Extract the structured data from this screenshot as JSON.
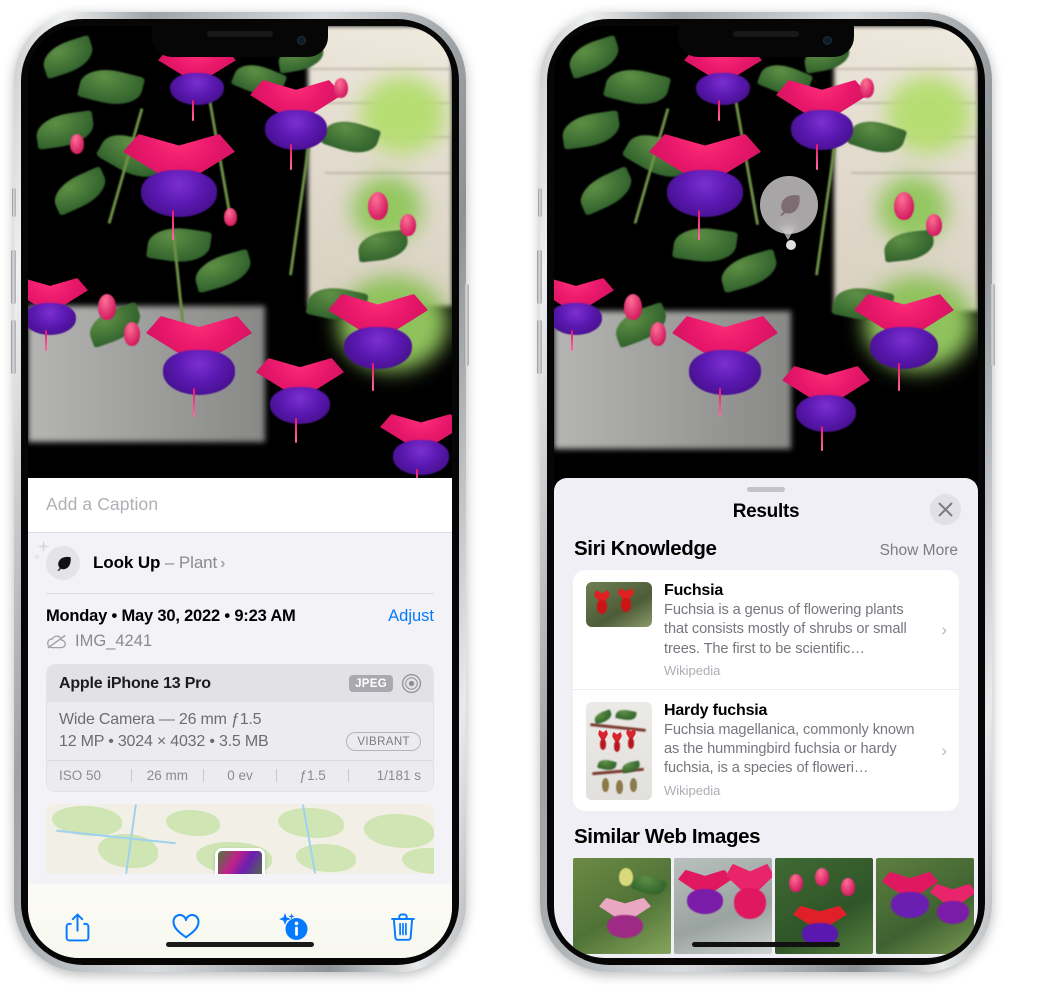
{
  "left_phone": {
    "name": "iPhone Photos detail view",
    "caption_field": {
      "placeholder": "Add a Caption",
      "value": ""
    },
    "lookup_row": {
      "title": "Look Up",
      "dash": " – ",
      "subject": "Plant",
      "chevron": "›",
      "icon": "leaf-icon"
    },
    "date_row": {
      "date_text": "Monday • May 30, 2022 • 9:23 AM",
      "adjust_label": "Adjust"
    },
    "filename_row": {
      "icon": "icloud-slash-icon",
      "filename": "IMG_4241"
    },
    "metadata_card": {
      "device": "Apple iPhone 13 Pro",
      "format_badge": "JPEG",
      "aperture_icon": "camera-aperture-icon",
      "lens_line": "Wide Camera — 26 mm ƒ1.5",
      "size_line": "12 MP • 3024 × 4032 • 3.5 MB",
      "style_badge": "VIBRANT",
      "exif": [
        {
          "label": "ISO 50"
        },
        {
          "label": "26 mm"
        },
        {
          "label": "0 ev"
        },
        {
          "label": "ƒ1.5"
        },
        {
          "label": "1/181 s"
        }
      ]
    },
    "map_preview": {
      "name": "location-map-thumbnail"
    },
    "toolbar": [
      {
        "name": "share-button",
        "icon": "share-icon"
      },
      {
        "name": "favorite-button",
        "icon": "heart-icon"
      },
      {
        "name": "info-button",
        "icon": "info-sparkle-icon"
      },
      {
        "name": "delete-button",
        "icon": "trash-icon"
      }
    ]
  },
  "right_phone": {
    "name": "Visual Look Up results sheet",
    "photo_badge": {
      "icon": "leaf-icon",
      "label": "visual-look-up-plant-badge"
    },
    "sheet": {
      "title": "Results",
      "close_label": "✕",
      "sections": [
        {
          "title": "Siri Knowledge",
          "action": "Show More",
          "cards": [
            {
              "title": "Fuchsia",
              "description": "Fuchsia is a genus of flowering plants that consists mostly of shrubs or small trees. The first to be scientific…",
              "source": "Wikipedia",
              "chevron": "›"
            },
            {
              "title": "Hardy fuchsia",
              "description": "Fuchsia magellanica, commonly known as the hummingbird fuchsia or hardy fuchsia, is a species of floweri…",
              "source": "Wikipedia",
              "chevron": "›"
            }
          ]
        },
        {
          "title": "Similar Web Images",
          "images": [
            {
              "name": "web-image-1"
            },
            {
              "name": "web-image-2"
            },
            {
              "name": "web-image-3"
            },
            {
              "name": "web-image-4"
            }
          ]
        }
      ]
    }
  },
  "colors": {
    "accent_blue": "#067aff",
    "sheet_bg": "#f0eff5",
    "info_bg": "#f2f2f7",
    "card_white": "#ffffff",
    "secondary_text": "#8a8a8f"
  }
}
